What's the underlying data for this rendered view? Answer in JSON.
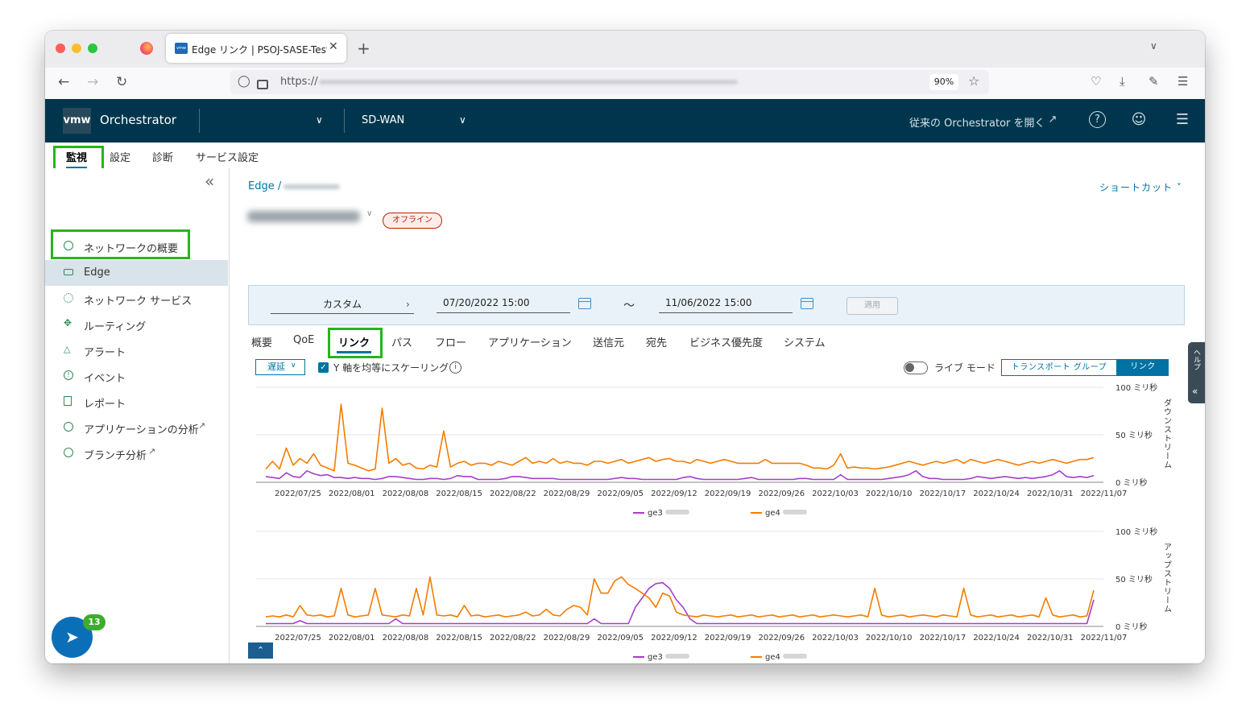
{
  "browser": {
    "tab_title": "Edge リンク | PSOJ-SASE-Test",
    "tab_close": "✕",
    "new_tab": "+",
    "url_prefix": "https://",
    "zoom": "90%"
  },
  "header": {
    "logo": "vmw",
    "app_name": "Orchestrator",
    "product": "SD-WAN",
    "legacy_link": "従来の Orchestrator を開く"
  },
  "top_tabs": [
    "監視",
    "設定",
    "診断",
    "サービス設定"
  ],
  "sidebar": {
    "items": [
      {
        "label": "ネットワークの概要",
        "icon": "gauge-icon"
      },
      {
        "label": "Edge",
        "icon": "edge-device-icon"
      },
      {
        "label": "ネットワーク サービス",
        "icon": "network-services-icon"
      },
      {
        "label": "ルーティング",
        "icon": "routing-icon"
      },
      {
        "label": "アラート",
        "icon": "alert-triangle-icon"
      },
      {
        "label": "イベント",
        "icon": "event-icon"
      },
      {
        "label": "レポート",
        "icon": "report-icon"
      },
      {
        "label": "アプリケーションの分析",
        "icon": "gauge-icon"
      },
      {
        "label": "ブランチ分析",
        "icon": "gauge-icon"
      }
    ],
    "notification_count": "13"
  },
  "main": {
    "breadcrumb_root": "Edge /",
    "shortcut": "ショートカット ˅",
    "status_badge": "オフライン",
    "date_range": {
      "preset": "カスタム",
      "start": "07/20/2022 15:00",
      "separator": "～",
      "end": "11/06/2022 15:00",
      "apply": "適用"
    },
    "sub_tabs": [
      "概要",
      "QoE",
      "リンク",
      "パス",
      "フロー",
      "アプリケーション",
      "送信元",
      "宛先",
      "ビジネス優先度",
      "システム"
    ],
    "active_sub_tab": "リンク",
    "metric_select": "遅延",
    "scale_checkbox_label": "Y 軸を均等にスケーリング",
    "live_mode_label": "ライブ モード",
    "view_toggle": [
      "トランスポート グループ",
      "リンク"
    ],
    "side_panel_label": "ヘルプ"
  },
  "chart_data": [
    {
      "type": "line",
      "ylabel": "ダウンストリーム",
      "y_ticks": [
        "100 ミリ秒",
        "50 ミリ秒",
        "0 ミリ秒"
      ],
      "ylim": [
        0,
        100
      ],
      "x_ticks": [
        "2022/07/25",
        "2022/08/01",
        "2022/08/08",
        "2022/08/15",
        "2022/08/22",
        "2022/08/29",
        "2022/09/05",
        "2022/09/12",
        "2022/09/19",
        "2022/09/26",
        "2022/10/03",
        "2022/10/10",
        "2022/10/17",
        "2022/10/24",
        "2022/10/31",
        "2022/11/07"
      ],
      "series": [
        {
          "name": "ge3",
          "color": "#a43fc9",
          "values": [
            6,
            5,
            4,
            10,
            6,
            5,
            12,
            9,
            7,
            8,
            5,
            5,
            4,
            5,
            4,
            4,
            3,
            4,
            6,
            6,
            5,
            4,
            3,
            3,
            4,
            4,
            3,
            4,
            7,
            6,
            6,
            3,
            3,
            3,
            3,
            4,
            6,
            6,
            5,
            4,
            4,
            4,
            4,
            3,
            3,
            3,
            3,
            3,
            3,
            3,
            3,
            4,
            5,
            4,
            4,
            3,
            3,
            3,
            3,
            3,
            3,
            5,
            6,
            4,
            3,
            3,
            3,
            3,
            3,
            3,
            4,
            5,
            3,
            3,
            3,
            3,
            3,
            3,
            4,
            4,
            3,
            3,
            3,
            3,
            8,
            3,
            3,
            3,
            3,
            3,
            3,
            4,
            5,
            6,
            8,
            12,
            6,
            4,
            4,
            3,
            3,
            3,
            3,
            4,
            6,
            5,
            4,
            5,
            6,
            5,
            4,
            5,
            4,
            5,
            6,
            8,
            12,
            6,
            5,
            6,
            5,
            7
          ]
        },
        {
          "name": "ge4",
          "color": "#f57c00",
          "values": [
            14,
            22,
            14,
            36,
            18,
            25,
            20,
            30,
            18,
            15,
            12,
            82,
            20,
            18,
            15,
            12,
            14,
            78,
            20,
            25,
            18,
            20,
            15,
            14,
            18,
            16,
            54,
            16,
            20,
            22,
            18,
            20,
            20,
            18,
            22,
            20,
            18,
            22,
            26,
            20,
            22,
            20,
            25,
            20,
            22,
            20,
            20,
            18,
            22,
            22,
            20,
            22,
            24,
            20,
            22,
            24,
            26,
            22,
            24,
            25,
            22,
            22,
            20,
            24,
            22,
            20,
            22,
            24,
            22,
            20,
            20,
            20,
            20,
            24,
            20,
            20,
            20,
            20,
            20,
            18,
            15,
            15,
            14,
            18,
            30,
            15,
            16,
            15,
            15,
            14,
            15,
            16,
            18,
            20,
            22,
            20,
            18,
            20,
            22,
            20,
            22,
            24,
            20,
            24,
            22,
            20,
            22,
            24,
            22,
            20,
            18,
            20,
            22,
            20,
            22,
            24,
            22,
            20,
            22,
            24,
            24,
            26
          ]
        }
      ]
    },
    {
      "type": "line",
      "ylabel": "アップストリーム",
      "y_ticks": [
        "100 ミリ秒",
        "50 ミリ秒",
        "0 ミリ秒"
      ],
      "ylim": [
        0,
        100
      ],
      "x_ticks": [
        "2022/07/25",
        "2022/08/01",
        "2022/08/08",
        "2022/08/15",
        "2022/08/22",
        "2022/08/29",
        "2022/09/05",
        "2022/09/12",
        "2022/09/19",
        "2022/09/26",
        "2022/10/03",
        "2022/10/10",
        "2022/10/17",
        "2022/10/24",
        "2022/10/31",
        "2022/11/07"
      ],
      "series": [
        {
          "name": "ge3",
          "color": "#a43fc9",
          "values": [
            3,
            3,
            3,
            3,
            3,
            6,
            3,
            3,
            3,
            3,
            3,
            3,
            3,
            3,
            3,
            3,
            3,
            3,
            3,
            8,
            3,
            3,
            3,
            3,
            3,
            3,
            3,
            3,
            3,
            3,
            3,
            3,
            3,
            3,
            3,
            3,
            3,
            3,
            3,
            3,
            3,
            3,
            3,
            3,
            3,
            3,
            3,
            3,
            8,
            3,
            3,
            3,
            3,
            3,
            20,
            30,
            40,
            45,
            46,
            40,
            28,
            20,
            8,
            3,
            3,
            3,
            3,
            3,
            3,
            3,
            3,
            3,
            3,
            3,
            3,
            3,
            3,
            3,
            3,
            3,
            3,
            3,
            3,
            3,
            3,
            3,
            3,
            3,
            3,
            3,
            3,
            3,
            3,
            3,
            3,
            3,
            3,
            3,
            3,
            3,
            3,
            3,
            3,
            3,
            3,
            3,
            3,
            3,
            3,
            3,
            3,
            3,
            3,
            3,
            3,
            3,
            3,
            3,
            3,
            3,
            3,
            28
          ]
        },
        {
          "name": "ge4",
          "color": "#f57c00",
          "values": [
            10,
            11,
            10,
            12,
            10,
            22,
            12,
            11,
            12,
            10,
            11,
            40,
            12,
            10,
            11,
            12,
            40,
            12,
            11,
            10,
            12,
            11,
            40,
            12,
            52,
            12,
            11,
            12,
            10,
            22,
            11,
            12,
            10,
            11,
            12,
            10,
            11,
            12,
            15,
            11,
            12,
            18,
            12,
            11,
            18,
            22,
            20,
            12,
            50,
            35,
            35,
            48,
            52,
            44,
            40,
            35,
            30,
            20,
            35,
            32,
            15,
            12,
            11,
            10,
            12,
            11,
            10,
            11,
            12,
            10,
            11,
            12,
            10,
            11,
            12,
            10,
            11,
            12,
            10,
            11,
            12,
            10,
            11,
            12,
            11,
            10,
            11,
            12,
            10,
            40,
            12,
            10,
            11,
            12,
            10,
            11,
            12,
            11,
            10,
            12,
            11,
            10,
            40,
            12,
            10,
            11,
            12,
            10,
            11,
            12,
            10,
            11,
            12,
            10,
            30,
            12,
            10,
            11,
            12,
            10,
            11,
            38
          ]
        }
      ]
    }
  ]
}
